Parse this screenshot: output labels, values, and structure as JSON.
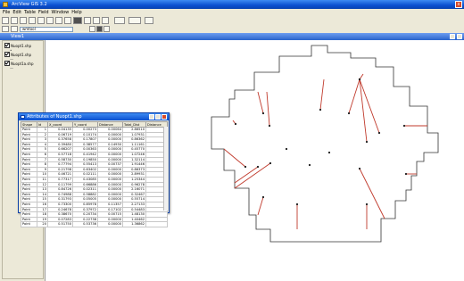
{
  "app": {
    "title": "ArcView GIS 3.2",
    "close_label": "x"
  },
  "menu": [
    "File",
    "Edit",
    "Table",
    "Field",
    "Window",
    "Help"
  ],
  "toolbar": {
    "combo_value": "wmtool"
  },
  "view_window": {
    "title": "View1"
  },
  "legend": {
    "layers": [
      {
        "name": "Nuopt1.shp"
      },
      {
        "name": "Nuopt1.shp"
      },
      {
        "name": "Nuopt1a.shp"
      }
    ]
  },
  "attributes_window": {
    "title": "Attributes of Nuopt1.shp",
    "columns": [
      "Shape",
      "Id",
      "X_coord",
      "Y_coord",
      "Distance",
      "Total_Dist",
      "Distance"
    ],
    "rows": [
      [
        "Point",
        "1",
        "0.04135",
        "0.00273",
        "0.00064",
        "2.86510"
      ],
      [
        "Point",
        "2",
        "0.06719",
        "0.10174",
        "0.00000",
        "1.07931"
      ],
      [
        "Point",
        "3",
        "0.37658",
        "0.17807",
        "0.00000",
        "0.86362"
      ],
      [
        "Point",
        "4",
        "0.39480",
        "0.38577",
        "0.14930",
        "1.11161"
      ],
      [
        "Point",
        "5",
        "0.66207",
        "0.00363",
        "0.00000",
        "0.45770"
      ],
      [
        "Point",
        "6",
        "0.57718",
        "0.41942",
        "0.00000",
        "1.07246"
      ],
      [
        "Point",
        "7",
        "0.58730",
        "0.19850",
        "0.00000",
        "1.32114"
      ],
      [
        "Point",
        "8",
        "0.77794",
        "0.55413",
        "0.00737",
        "1.91446"
      ],
      [
        "Point",
        "9",
        "0.21798",
        "0.63402",
        "0.00000",
        "0.86373"
      ],
      [
        "Point",
        "10",
        "0.46721",
        "0.02111",
        "0.00000",
        "2.89931"
      ],
      [
        "Point",
        "11",
        "0.77317",
        "0.43085",
        "0.00000",
        "1.25344"
      ],
      [
        "Point",
        "12",
        "0.11799",
        "0.66886",
        "0.00000",
        "0.96278"
      ],
      [
        "Point",
        "13",
        "0.84726",
        "0.02311",
        "0.00000",
        "2.16071"
      ],
      [
        "Point",
        "14",
        "0.74988",
        "0.58882",
        "0.00000",
        "0.32467"
      ],
      [
        "Point",
        "15",
        "0.31793",
        "0.05005",
        "0.00000",
        "0.55714"
      ],
      [
        "Point",
        "16",
        "0.73300",
        "0.85978",
        "0.11357",
        "2.27133"
      ],
      [
        "Point",
        "17",
        "0.24678",
        "0.37972",
        "0.17102",
        "0.54483"
      ],
      [
        "Point",
        "18",
        "0.38670",
        "0.20734",
        "0.00715",
        "1.48130"
      ],
      [
        "Point",
        "19",
        "0.07283",
        "0.22738",
        "0.00000",
        "1.40462"
      ],
      [
        "Point",
        "20",
        "0.51750",
        "0.53736",
        "0.00000",
        "1.36862"
      ]
    ]
  },
  "colors": {
    "title_bar": "#0a4fd0",
    "polygon_outline": "#333333",
    "connector_lines": "#c0392b",
    "points": "#1a1a1a"
  }
}
